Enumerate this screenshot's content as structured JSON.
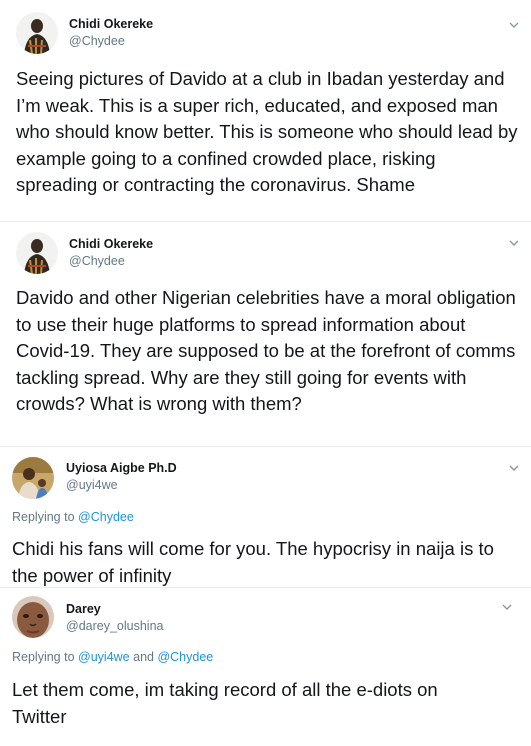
{
  "tweets": [
    {
      "name": "Chidi Okereke",
      "handle": "@Chydee",
      "text": "Seeing pictures of Davido at a club in Ibadan yesterday and I’m weak. This is a super rich, educated, and exposed man who should know better. This is someone who should lead by example going to a confined crowded place, risking spreading or contracting the coronavirus. Shame"
    },
    {
      "name": "Chidi Okereke",
      "handle": "@Chydee",
      "text": "Davido and other Nigerian celebrities have a moral obligation to use their huge platforms to spread information about Covid-19. They are supposed to be at the forefront of comms tackling spread. Why are they still going for events with crowds? What is wrong with them?"
    },
    {
      "name": "Uyiosa Aigbe Ph.D",
      "handle": "@uyi4we",
      "reply_prefix": "Replying to",
      "reply_to_1": "@Chydee",
      "text": "Chidi his fans will come for you. The hypocrisy in naija is to the power of infinity"
    },
    {
      "name": "Darey",
      "handle": "@darey_olushina",
      "reply_prefix": "Replying to",
      "reply_to_1": "@uyi4we",
      "reply_and": "and",
      "reply_to_2": "@Chydee",
      "text": "Let them come, im taking record of all the e-diots on Twitter"
    }
  ],
  "icons": {
    "more": "chevron-down-icon"
  },
  "colors": {
    "link": "#1b95e0",
    "muted": "#657786",
    "text": "#14171a",
    "divider": "#e6ecf0"
  }
}
